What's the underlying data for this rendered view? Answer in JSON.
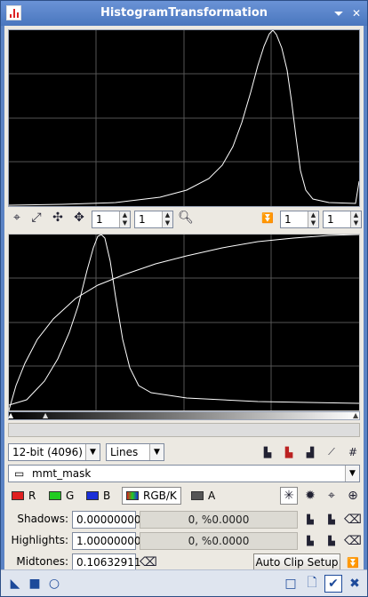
{
  "window": {
    "title": "HistogramTransformation"
  },
  "top_toolbar": {
    "zoom_x": "1",
    "zoom_y": "1",
    "zoom_x2": "1",
    "zoom_y2": "1"
  },
  "controls": {
    "bit_depth": "12-bit (4096)",
    "graph_style": "Lines",
    "view_selected": "mmt_mask",
    "channels": [
      {
        "label": "R",
        "color": "#e02020"
      },
      {
        "label": "G",
        "color": "#22cc22"
      },
      {
        "label": "B",
        "color": "#1a2fd8"
      },
      {
        "label": "RGB/K",
        "color": "#808080"
      },
      {
        "label": "A",
        "color": "#555555"
      }
    ],
    "shadows_label": "Shadows:",
    "shadows_value": "0.00000000",
    "shadows_readout": "0, %0.0000",
    "highlights_label": "Highlights:",
    "highlights_value": "1.00000000",
    "highlights_readout": "0, %0.0000",
    "midtones_label": "Midtones:",
    "midtones_value": "0.10632911",
    "auto_clip_label": "Auto Clip Setup"
  }
}
